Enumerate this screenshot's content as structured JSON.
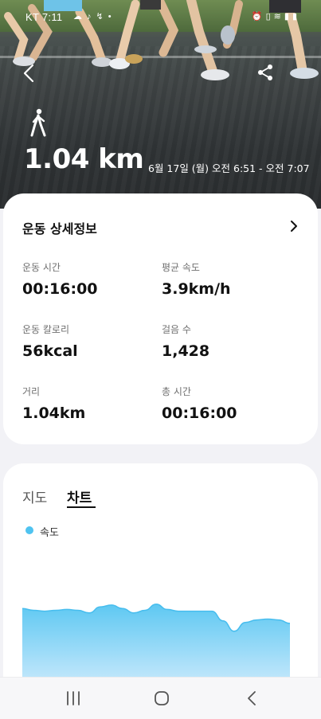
{
  "status_bar": {
    "carrier": "KT",
    "time": "7:11"
  },
  "header": {
    "activity_icon": "walking-person-icon",
    "distance": "1.04 km",
    "datetime": "6월 17일 (월) 오전 6:51 - 오전 7:07"
  },
  "details_card": {
    "title": "운동 상세정보",
    "stats": [
      {
        "label": "운동 시간",
        "value": "00:16:00"
      },
      {
        "label": "평균 속도",
        "value": "3.9km/h"
      },
      {
        "label": "운동 칼로리",
        "value": "56kcal"
      },
      {
        "label": "걸음 수",
        "value": "1,428"
      },
      {
        "label": "거리",
        "value": "1.04km"
      },
      {
        "label": "총 시간",
        "value": "00:16:00"
      }
    ]
  },
  "chart_card": {
    "tabs": [
      {
        "label": "지도",
        "active": false
      },
      {
        "label": "차트",
        "active": true
      }
    ],
    "legend": "속도",
    "accent": "#4fc3f0"
  },
  "chart_data": {
    "type": "area",
    "series": [
      {
        "name": "속도",
        "values": [
          4.0,
          3.9,
          3.85,
          3.9,
          3.95,
          3.9,
          3.75,
          4.1,
          4.2,
          4.0,
          3.75,
          3.9,
          4.25,
          3.95,
          3.85,
          3.85,
          3.85,
          3.85,
          3.3,
          2.7,
          3.2,
          3.35,
          3.4,
          3.35,
          3.15
        ]
      }
    ],
    "title": "",
    "xlabel": "",
    "ylabel": "",
    "grid": false
  }
}
